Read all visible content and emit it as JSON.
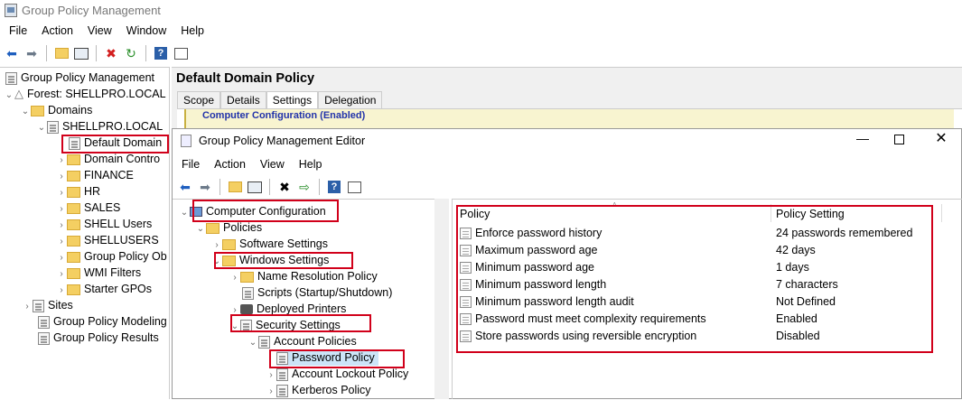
{
  "main_window": {
    "title": "Group Policy Management",
    "menu": [
      "File",
      "Action",
      "View",
      "Window",
      "Help"
    ],
    "tree": [
      {
        "label": "Group Policy Management",
        "level": 0,
        "expanded": true
      },
      {
        "label": "Forest: SHELLPRO.LOCAL",
        "level": 1,
        "expanded": true
      },
      {
        "label": "Domains",
        "level": 2,
        "expanded": true
      },
      {
        "label": "SHELLPRO.LOCAL",
        "level": 3,
        "expanded": true
      },
      {
        "label": "Default Domain",
        "level": 4,
        "expanded": false,
        "selected": true
      },
      {
        "label": "Domain Contro",
        "level": 4,
        "expanded": false
      },
      {
        "label": "FINANCE",
        "level": 4,
        "expanded": false
      },
      {
        "label": "HR",
        "level": 4,
        "expanded": false
      },
      {
        "label": "SALES",
        "level": 4,
        "expanded": false
      },
      {
        "label": "SHELL Users",
        "level": 4,
        "expanded": false
      },
      {
        "label": "SHELLUSERS",
        "level": 4,
        "expanded": false
      },
      {
        "label": "Group Policy Ob",
        "level": 4,
        "expanded": false
      },
      {
        "label": "WMI Filters",
        "level": 4,
        "expanded": false
      },
      {
        "label": "Starter GPOs",
        "level": 4,
        "expanded": false
      },
      {
        "label": "Sites",
        "level": 1,
        "expanded": false
      },
      {
        "label": "Group Policy Modeling",
        "level": 1,
        "expanded": false
      },
      {
        "label": "Group Policy Results",
        "level": 1,
        "expanded": false
      }
    ],
    "right_header": "Default Domain Policy",
    "tabs": [
      "Scope",
      "Details",
      "Settings",
      "Delegation"
    ],
    "active_tab": "Settings",
    "settings_peek": "Computer Configuration (Enabled)"
  },
  "editor": {
    "title": "Group Policy Management Editor",
    "menu": [
      "File",
      "Action",
      "View",
      "Help"
    ],
    "tree": [
      {
        "label": "Computer Configuration",
        "level": 0,
        "expanded": true
      },
      {
        "label": "Policies",
        "level": 1,
        "expanded": true
      },
      {
        "label": "Software Settings",
        "level": 2,
        "expanded": false
      },
      {
        "label": "Windows Settings",
        "level": 2,
        "expanded": true
      },
      {
        "label": "Name Resolution Policy",
        "level": 3,
        "expanded": false
      },
      {
        "label": "Scripts (Startup/Shutdown)",
        "level": 3,
        "expanded": false
      },
      {
        "label": "Deployed Printers",
        "level": 3,
        "expanded": false
      },
      {
        "label": "Security Settings",
        "level": 3,
        "expanded": true
      },
      {
        "label": "Account Policies",
        "level": 4,
        "expanded": true
      },
      {
        "label": "Password Policy",
        "level": 5,
        "expanded": false,
        "selected": true
      },
      {
        "label": "Account Lockout Policy",
        "level": 5,
        "expanded": false
      },
      {
        "label": "Kerberos Policy",
        "level": 5,
        "expanded": false
      }
    ],
    "list_headers": [
      "Policy",
      "Policy Setting"
    ],
    "policies": [
      {
        "policy": "Enforce password history",
        "setting": "24 passwords remembered"
      },
      {
        "policy": "Maximum password age",
        "setting": "42 days"
      },
      {
        "policy": "Minimum password age",
        "setting": "1 days"
      },
      {
        "policy": "Minimum password length",
        "setting": "7 characters"
      },
      {
        "policy": "Minimum password length audit",
        "setting": "Not Defined"
      },
      {
        "policy": "Password must meet complexity requirements",
        "setting": "Enabled"
      },
      {
        "policy": "Store passwords using reversible encryption",
        "setting": "Disabled"
      }
    ]
  }
}
